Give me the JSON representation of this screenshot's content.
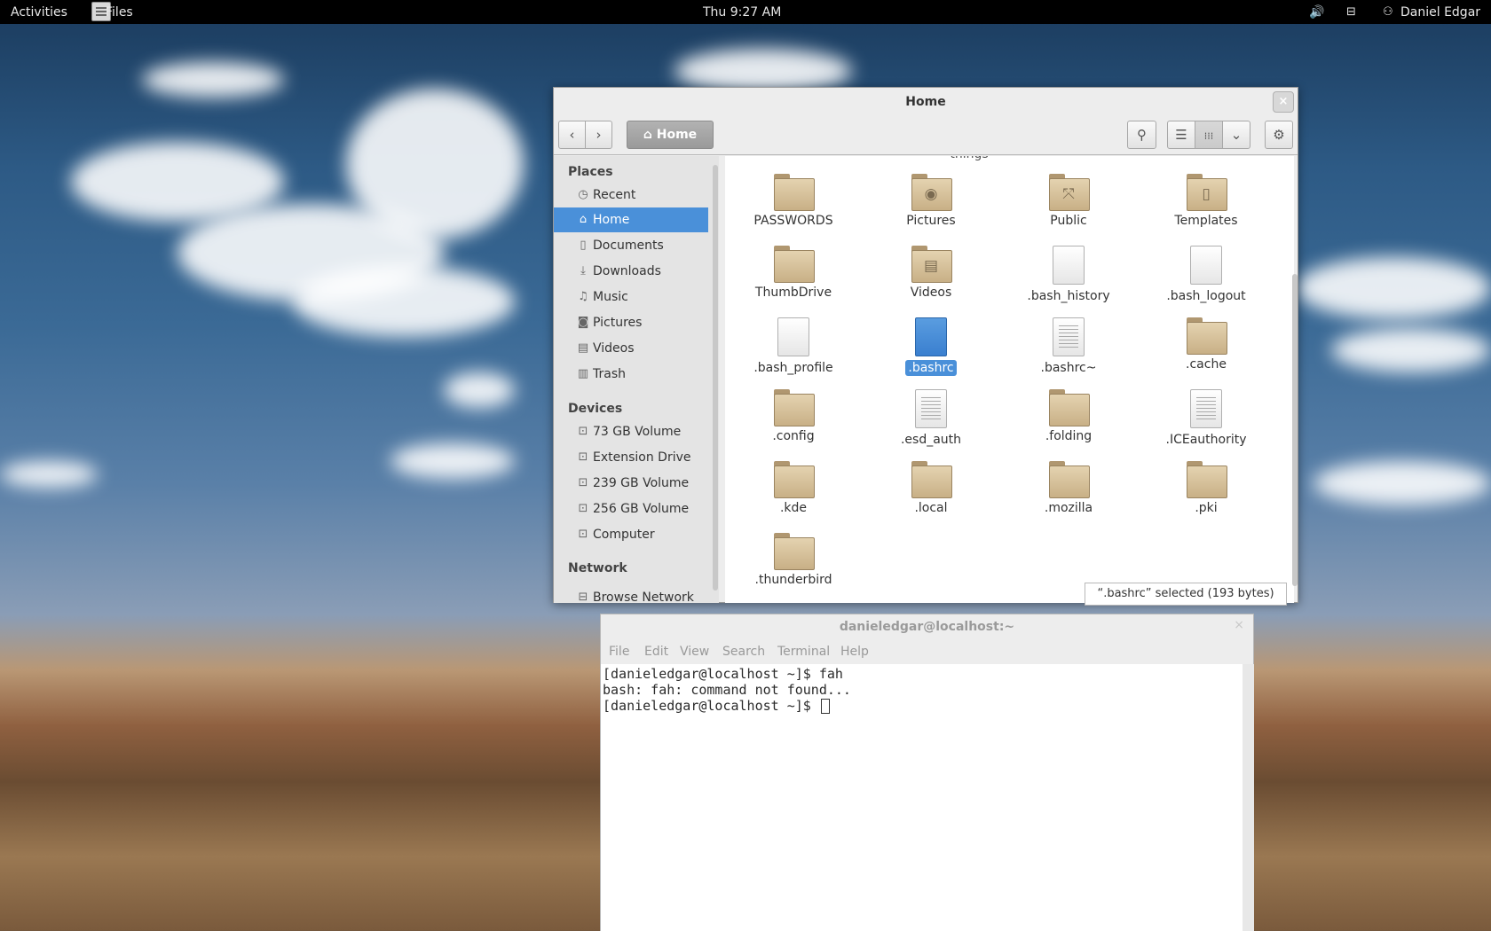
{
  "topbar": {
    "activities": "Activities",
    "app_name": "Files",
    "clock": "Thu  9:27 AM",
    "user": "Daniel Edgar",
    "icons": [
      "volume-icon",
      "network-icon",
      "user-icon"
    ]
  },
  "files": {
    "title": "Home",
    "toolbar": {
      "back": "‹",
      "forward": "›",
      "location": "Home",
      "search_icon": "search-icon",
      "list_icon": "list-view-icon",
      "grid_icon": "grid-view-icon",
      "view_menu_icon": "chevron-down-icon",
      "settings_icon": "gear-icon",
      "close": "×"
    },
    "sidebar": {
      "places_heading": "Places",
      "places": [
        {
          "label": "Recent",
          "icon": "clock-icon"
        },
        {
          "label": "Home",
          "icon": "home-icon"
        },
        {
          "label": "Documents",
          "icon": "document-icon"
        },
        {
          "label": "Downloads",
          "icon": "download-icon"
        },
        {
          "label": "Music",
          "icon": "music-icon"
        },
        {
          "label": "Pictures",
          "icon": "camera-icon"
        },
        {
          "label": "Videos",
          "icon": "film-icon"
        },
        {
          "label": "Trash",
          "icon": "trash-icon"
        }
      ],
      "devices_heading": "Devices",
      "devices": [
        {
          "label": "73 GB Volume",
          "icon": "drive-icon"
        },
        {
          "label": "Extension Drive",
          "icon": "drive-icon"
        },
        {
          "label": "239 GB Volume",
          "icon": "drive-icon"
        },
        {
          "label": "256 GB Volume",
          "icon": "drive-icon"
        },
        {
          "label": "Computer",
          "icon": "drive-icon"
        }
      ],
      "network_heading": "Network",
      "network": [
        {
          "label": "Browse Network",
          "icon": "network-icon"
        }
      ]
    },
    "cut_off_label": "things",
    "items": [
      {
        "name": "PASSWORDS",
        "type": "folder"
      },
      {
        "name": "Pictures",
        "type": "folder-pictures"
      },
      {
        "name": "Public",
        "type": "folder-public"
      },
      {
        "name": "Templates",
        "type": "folder-templates"
      },
      {
        "name": "ThumbDrive",
        "type": "folder"
      },
      {
        "name": "Videos",
        "type": "folder-videos"
      },
      {
        "name": ".bash_history",
        "type": "file"
      },
      {
        "name": ".bash_logout",
        "type": "file"
      },
      {
        "name": ".bash_profile",
        "type": "file"
      },
      {
        "name": ".bashrc",
        "type": "file-selected"
      },
      {
        "name": ".bashrc~",
        "type": "file-text"
      },
      {
        "name": ".cache",
        "type": "folder"
      },
      {
        "name": ".config",
        "type": "folder"
      },
      {
        "name": ".esd_auth",
        "type": "file-text"
      },
      {
        "name": ".folding",
        "type": "folder"
      },
      {
        "name": ".ICEauthority",
        "type": "file-text"
      },
      {
        "name": ".kde",
        "type": "folder"
      },
      {
        "name": ".local",
        "type": "folder"
      },
      {
        "name": ".mozilla",
        "type": "folder"
      },
      {
        "name": ".pki",
        "type": "folder"
      },
      {
        "name": ".thunderbird",
        "type": "folder"
      }
    ],
    "status": "“.bashrc” selected  (193 bytes)"
  },
  "terminal": {
    "title": "danieledgar@localhost:~",
    "close": "×",
    "menu": [
      "File",
      "Edit",
      "View",
      "Search",
      "Terminal",
      "Help"
    ],
    "lines": [
      "[danieledgar@localhost ~]$ fah",
      "bash: fah: command not found...",
      "[danieledgar@localhost ~]$ "
    ]
  }
}
